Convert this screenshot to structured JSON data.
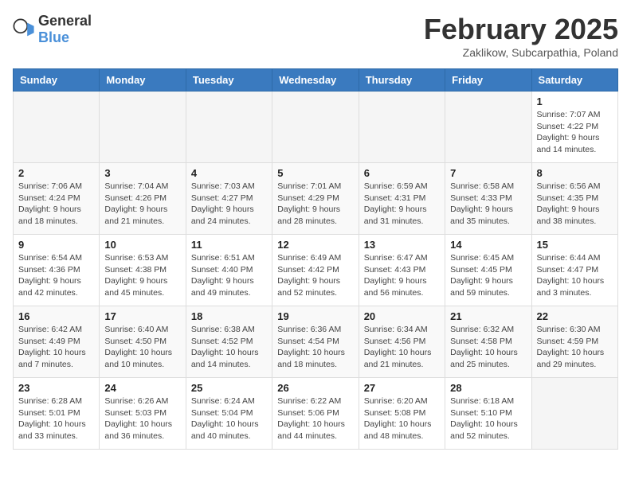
{
  "header": {
    "logo_general": "General",
    "logo_blue": "Blue",
    "month_title": "February 2025",
    "subtitle": "Zaklikow, Subcarpathia, Poland"
  },
  "weekdays": [
    "Sunday",
    "Monday",
    "Tuesday",
    "Wednesday",
    "Thursday",
    "Friday",
    "Saturday"
  ],
  "weeks": [
    [
      {
        "day": "",
        "info": ""
      },
      {
        "day": "",
        "info": ""
      },
      {
        "day": "",
        "info": ""
      },
      {
        "day": "",
        "info": ""
      },
      {
        "day": "",
        "info": ""
      },
      {
        "day": "",
        "info": ""
      },
      {
        "day": "1",
        "info": "Sunrise: 7:07 AM\nSunset: 4:22 PM\nDaylight: 9 hours and 14 minutes."
      }
    ],
    [
      {
        "day": "2",
        "info": "Sunrise: 7:06 AM\nSunset: 4:24 PM\nDaylight: 9 hours and 18 minutes."
      },
      {
        "day": "3",
        "info": "Sunrise: 7:04 AM\nSunset: 4:26 PM\nDaylight: 9 hours and 21 minutes."
      },
      {
        "day": "4",
        "info": "Sunrise: 7:03 AM\nSunset: 4:27 PM\nDaylight: 9 hours and 24 minutes."
      },
      {
        "day": "5",
        "info": "Sunrise: 7:01 AM\nSunset: 4:29 PM\nDaylight: 9 hours and 28 minutes."
      },
      {
        "day": "6",
        "info": "Sunrise: 6:59 AM\nSunset: 4:31 PM\nDaylight: 9 hours and 31 minutes."
      },
      {
        "day": "7",
        "info": "Sunrise: 6:58 AM\nSunset: 4:33 PM\nDaylight: 9 hours and 35 minutes."
      },
      {
        "day": "8",
        "info": "Sunrise: 6:56 AM\nSunset: 4:35 PM\nDaylight: 9 hours and 38 minutes."
      }
    ],
    [
      {
        "day": "9",
        "info": "Sunrise: 6:54 AM\nSunset: 4:36 PM\nDaylight: 9 hours and 42 minutes."
      },
      {
        "day": "10",
        "info": "Sunrise: 6:53 AM\nSunset: 4:38 PM\nDaylight: 9 hours and 45 minutes."
      },
      {
        "day": "11",
        "info": "Sunrise: 6:51 AM\nSunset: 4:40 PM\nDaylight: 9 hours and 49 minutes."
      },
      {
        "day": "12",
        "info": "Sunrise: 6:49 AM\nSunset: 4:42 PM\nDaylight: 9 hours and 52 minutes."
      },
      {
        "day": "13",
        "info": "Sunrise: 6:47 AM\nSunset: 4:43 PM\nDaylight: 9 hours and 56 minutes."
      },
      {
        "day": "14",
        "info": "Sunrise: 6:45 AM\nSunset: 4:45 PM\nDaylight: 9 hours and 59 minutes."
      },
      {
        "day": "15",
        "info": "Sunrise: 6:44 AM\nSunset: 4:47 PM\nDaylight: 10 hours and 3 minutes."
      }
    ],
    [
      {
        "day": "16",
        "info": "Sunrise: 6:42 AM\nSunset: 4:49 PM\nDaylight: 10 hours and 7 minutes."
      },
      {
        "day": "17",
        "info": "Sunrise: 6:40 AM\nSunset: 4:50 PM\nDaylight: 10 hours and 10 minutes."
      },
      {
        "day": "18",
        "info": "Sunrise: 6:38 AM\nSunset: 4:52 PM\nDaylight: 10 hours and 14 minutes."
      },
      {
        "day": "19",
        "info": "Sunrise: 6:36 AM\nSunset: 4:54 PM\nDaylight: 10 hours and 18 minutes."
      },
      {
        "day": "20",
        "info": "Sunrise: 6:34 AM\nSunset: 4:56 PM\nDaylight: 10 hours and 21 minutes."
      },
      {
        "day": "21",
        "info": "Sunrise: 6:32 AM\nSunset: 4:58 PM\nDaylight: 10 hours and 25 minutes."
      },
      {
        "day": "22",
        "info": "Sunrise: 6:30 AM\nSunset: 4:59 PM\nDaylight: 10 hours and 29 minutes."
      }
    ],
    [
      {
        "day": "23",
        "info": "Sunrise: 6:28 AM\nSunset: 5:01 PM\nDaylight: 10 hours and 33 minutes."
      },
      {
        "day": "24",
        "info": "Sunrise: 6:26 AM\nSunset: 5:03 PM\nDaylight: 10 hours and 36 minutes."
      },
      {
        "day": "25",
        "info": "Sunrise: 6:24 AM\nSunset: 5:04 PM\nDaylight: 10 hours and 40 minutes."
      },
      {
        "day": "26",
        "info": "Sunrise: 6:22 AM\nSunset: 5:06 PM\nDaylight: 10 hours and 44 minutes."
      },
      {
        "day": "27",
        "info": "Sunrise: 6:20 AM\nSunset: 5:08 PM\nDaylight: 10 hours and 48 minutes."
      },
      {
        "day": "28",
        "info": "Sunrise: 6:18 AM\nSunset: 5:10 PM\nDaylight: 10 hours and 52 minutes."
      },
      {
        "day": "",
        "info": ""
      }
    ]
  ]
}
